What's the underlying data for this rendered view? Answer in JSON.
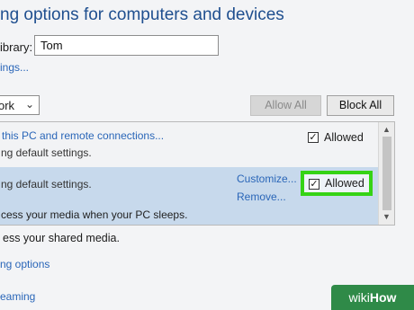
{
  "header": {
    "title": "ng options for computers and devices"
  },
  "library": {
    "label": "ibrary:",
    "value": "Tom"
  },
  "links": {
    "settings": "ings..."
  },
  "toolbar": {
    "network_dropdown": "ork",
    "allow_all": "Allow All",
    "block_all": "Block All"
  },
  "list": {
    "row1": {
      "link": "this PC and remote connections...",
      "desc": "ng default settings.",
      "checkbox_label": "Allowed",
      "checked": true
    },
    "row2": {
      "desc1": "ng default settings.",
      "desc2": "cess your media when your PC sleeps.",
      "customize": "Customize...",
      "remove": "Remove...",
      "checkbox_label": "Allowed",
      "checked": true
    }
  },
  "footer": {
    "shared_media": "ess your shared media.",
    "options_link": "ng options",
    "streaming_link": "eaming"
  },
  "watermark": {
    "wiki": "wiki",
    "how": "How"
  },
  "colors": {
    "title": "#1f4f8f",
    "link": "#2a66b8",
    "selection": "#c7d9ec",
    "highlight": "#35d315",
    "watermark_bg": "#2f8a48"
  }
}
